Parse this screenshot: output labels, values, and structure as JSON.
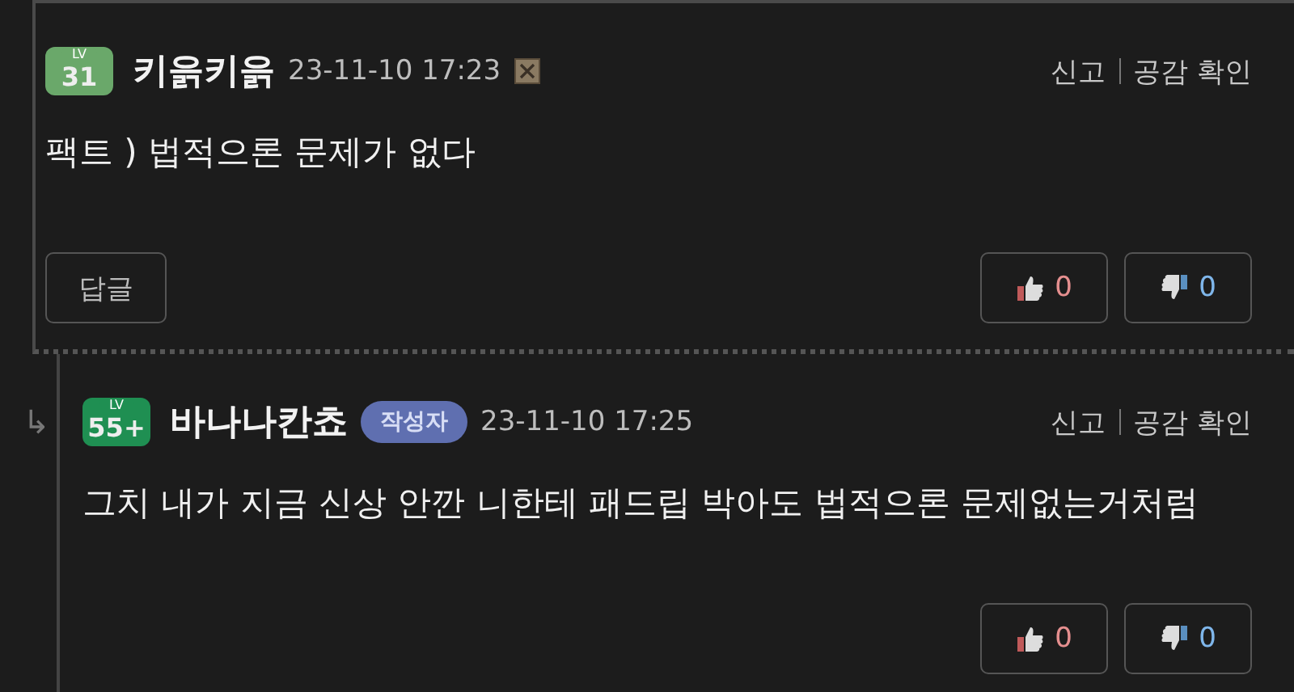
{
  "comments": [
    {
      "reply": false,
      "level_label": "LV",
      "level": "31",
      "color": "#6aa86a",
      "nickname": "키읅키읅",
      "time": "23-11-10 17:23",
      "has_block_icon": true,
      "actions": [
        "신고",
        "공감 확인"
      ],
      "body": "팩트 ) 법적으론 문제가 없다",
      "reply_button": "답글",
      "likes": "0",
      "dislikes": "0"
    },
    {
      "reply": true,
      "reply_arrow": "↳",
      "level_label": "LV",
      "level": "55+",
      "color": "#1f8f52",
      "nickname": "바나나칸쵸",
      "author_badge": "작성자",
      "time": "23-11-10 17:25",
      "has_block_icon": false,
      "actions": [
        "신고",
        "공감 확인"
      ],
      "body": "그치 내가 지금 신상 안깐 니한테 패드립 박아도 법적으론 문제없는거처럼",
      "likes": "0",
      "dislikes": "0"
    }
  ]
}
